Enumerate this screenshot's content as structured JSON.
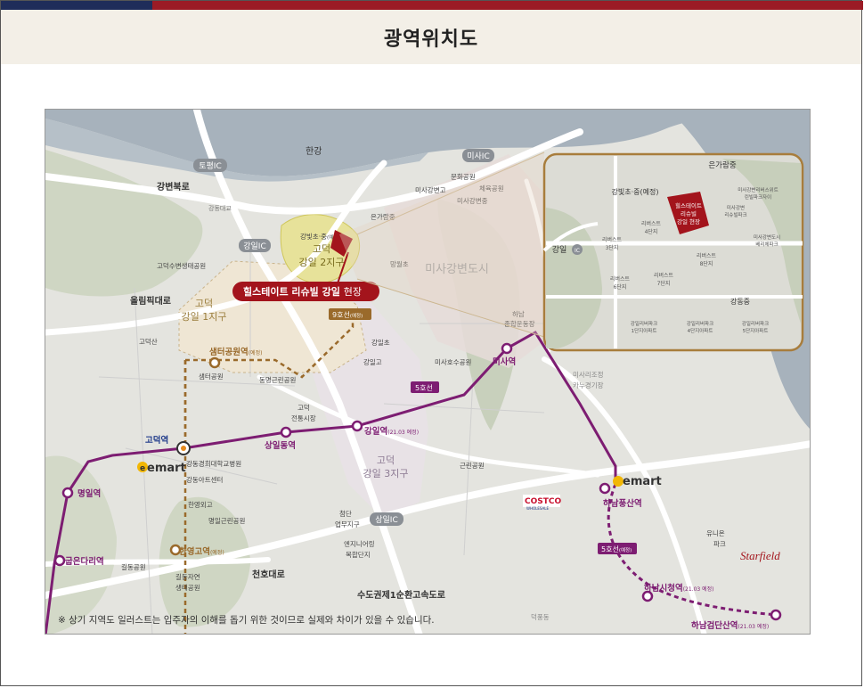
{
  "page": {
    "title": "광역위치도"
  },
  "site": {
    "name": "힐스테이트 리슈빌 강일",
    "suffix": "현장"
  },
  "inset": {
    "site_label": [
      "힐스테이트",
      "리슈빌",
      "강일 현장"
    ],
    "labels": {
      "gangil_ic": "강일",
      "ic_badge": "IC",
      "school_gangbit": "강빛초·중(예정)",
      "eun_garam": "은가람중",
      "gangdong": "강동중",
      "rivest3": [
        "리버스트",
        "3단지"
      ],
      "rivest4": [
        "리버스트",
        "4단지"
      ],
      "rivest6": [
        "리버스트",
        "6단지"
      ],
      "rivest7": [
        "리버스트",
        "7단지"
      ],
      "rivest8": [
        "리버스트",
        "8단지"
      ],
      "misa_lotte": [
        "미사강변리버스위트",
        "린빌파크자이"
      ],
      "misa_riverview": [
        "미사강변",
        "리슈빌파크"
      ],
      "misa_gangbyeon": [
        "미사강변도시",
        "베리체파크"
      ],
      "gangil_1": [
        "강일리버파크",
        "1단지아파트"
      ],
      "gangil_4": [
        "강일리버파크",
        "4단지아파트"
      ],
      "gangil_5": [
        "강일리버파크",
        "5단지아파트"
      ]
    }
  },
  "districts": {
    "godeok2": [
      "고덕",
      "강일 2지구"
    ],
    "godeok1": [
      "고덕",
      "강일 1지구"
    ],
    "godeok3": [
      "고덕",
      "강일 3지구"
    ],
    "misa": "미사강변도시"
  },
  "roads": {
    "hangang": "한강",
    "topyeong_ic": "토평IC",
    "misa_ic": "미사IC",
    "gangil_ic": "강일IC",
    "sangil_ic": "상일IC",
    "gangbyeonbukro": "강변북로",
    "olympic": "올림픽대로",
    "cheonho": "천호대로",
    "ring_expressway": "수도권제1순환고속도로",
    "gangdong_bridge": "강동대교"
  },
  "lines": {
    "line5": "5호선",
    "line9": "9호선",
    "line9_sub": "(예정)",
    "line5b": "5호선",
    "line5b_sub": "(예정)"
  },
  "stations": {
    "godeok": "고덕역",
    "sangildong": "상일동역",
    "gangil": "강일역",
    "gangil_sub": "(21.03 예정)",
    "misa": "미사역",
    "myeongil": "명일역",
    "gubeundari": "굽은다리역",
    "semter": "샘터공원역",
    "semter_sub": "(예정)",
    "hanyanggo": "한영고역",
    "hanyanggo_sub": "(예정)",
    "hanampungsan": "하남풍산역",
    "hanamsicheong": "하남시청역",
    "hanamsicheong_sub": "(21.03 예정)",
    "hanamgeomdan": "하남검단산역",
    "hanamgeomdan_sub": "(21.03 예정)"
  },
  "places": {
    "munhwa_park": "문화공원",
    "misa_gangbyeon_go": "미사강변고",
    "cheyuk_park": "체육공원",
    "misa_gangbyeon_jung": "미사강변중",
    "eungaram": "은가람중",
    "gangbit": "강빛초·중",
    "gangbit_sub": "(예정)",
    "manguel": "망월초",
    "godeok_eco": "고덕수변생태공원",
    "godeoksan": "고덕산",
    "semter_park": "샘터공원",
    "dongmyeong_park": "동명근린공원",
    "godeok_market": [
      "고덕",
      "전통시장"
    ],
    "gangil_cho": "강일초",
    "gangil_go": "강일고",
    "misaho_park": "미사호수공원",
    "geunrin_park": "근린공원",
    "hanam_stadium": [
      "하남",
      "종합운동장"
    ],
    "misa_rowing": [
      "미사리조정",
      "카누경기장"
    ],
    "hospital": "강동경희대학교병원",
    "arts_center": "강동아트센터",
    "hanyoung": "한영외고",
    "myeongil_park": "명일근린공원",
    "gildong_park": "길동공원",
    "gildong_eco": [
      "길동자연",
      "생태공원"
    ],
    "cheomdan": [
      "첨단",
      "업무지구"
    ],
    "entertainment": [
      "엔지니어링",
      "복합단지"
    ],
    "union_park": [
      "유니온",
      "파크"
    ],
    "deokpung": "덕풍동"
  },
  "brands": {
    "emart": "emart",
    "emart_e": "e",
    "costco": "COSTCO",
    "costco_sub": "WHOLESALE",
    "starfield": "Starfield"
  },
  "notice": "※ 상기 지역도 일러스트는 입주자의 이해를 돕기 위한 것이므로 실제와 차이가 있을 수 있습니다.",
  "colors": {
    "line5": "#7d1d72",
    "line9": "#9a6a2b",
    "site": "#a3141c",
    "water": "#a8b4bf",
    "land": "#e7e7e2",
    "park": "#cdd4c0",
    "road": "#ffffff"
  }
}
